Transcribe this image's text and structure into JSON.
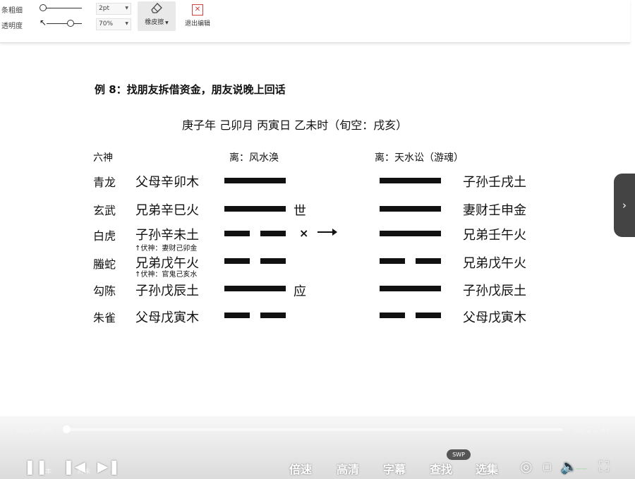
{
  "toolbar": {
    "thickness_label": "条粗细",
    "opacity_label": "透明度",
    "thickness_value": "2pt",
    "opacity_value": "70%",
    "eraser_label": "橡皮擦",
    "exit_label": "退出编辑"
  },
  "slide": {
    "title": "例 8：找朋友拆借资金，朋友说晚上回话",
    "date_line": "庚子年  己卯月  丙寅日  乙未时（旬空：戌亥）",
    "col_six_gods": "六神",
    "col_left_hex": "离：风水涣",
    "col_right_hex": "离：天水讼（游魂）",
    "six_gods": [
      "青龙",
      "玄武",
      "白虎",
      "螣蛇",
      "勾陈",
      "朱雀"
    ],
    "left_lines": [
      "父母辛卯木",
      "兄弟辛巳火",
      "子孙辛未土",
      "兄弟戊午火",
      "子孙戊辰土",
      "父母戊寅木"
    ],
    "right_lines": [
      "子孙壬戌土",
      "妻财壬申金",
      "兄弟壬午火",
      "兄弟戊午火",
      "子孙戊辰土",
      "父母戊寅木"
    ],
    "fushen_1": "伏神：妻财己卯金",
    "fushen_2": "伏神：官鬼己亥水",
    "shi_marker": "世",
    "ying_marker": "应",
    "moving_mark": "×",
    "left_yao": [
      "yang",
      "yang",
      "yin",
      "yin",
      "yang",
      "yin"
    ],
    "right_yao": [
      "yang",
      "yang",
      "yang",
      "yin",
      "yang",
      "yin"
    ]
  },
  "player": {
    "time_current": "00:00:06",
    "time_total": "00:21:47",
    "progress": 0.0046,
    "speed_label": "倍速",
    "quality_label": "高清",
    "subtitle_label": "字幕",
    "search_label": "查找",
    "episodes_label": "选集",
    "swp_badge": "SWP",
    "faded_text_1": "本",
    "faded_text_2": "附未",
    "watermark": "——"
  },
  "icons": [
    "cursor-icon",
    "eraser-icon",
    "close-box-icon",
    "chevron-right-icon",
    "pause-icon",
    "prev-icon",
    "next-icon",
    "settings-icon",
    "volume-icon",
    "fullscreen-icon",
    "screen-icon"
  ]
}
